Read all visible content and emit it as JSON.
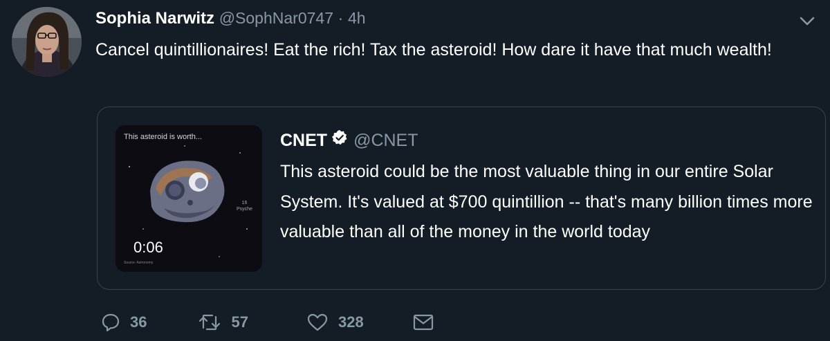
{
  "tweet": {
    "author_name": "Sophia Narwitz",
    "author_handle": "@SophNar0747",
    "separator": "·",
    "time": "4h",
    "text": "Cancel quintillionaires! Eat the rich! Tax the asteroid! How dare it have that much wealth!"
  },
  "quoted_tweet": {
    "author_name": "CNET",
    "author_handle": "@CNET",
    "verified": true,
    "text": "This asteroid could be the most valuable thing in our entire Solar System. It's valued at $700 quintillion -- that's many billion times more valuable than all of the money in the world today",
    "media": {
      "caption": "This asteroid is worth...",
      "side_text": "16\nPsyche",
      "duration": "0:06",
      "footnote": "Source: Astronomy"
    }
  },
  "actions": {
    "reply_count": "36",
    "retweet_count": "57",
    "like_count": "328"
  },
  "colors": {
    "background": "#141d26",
    "secondary_text": "#8899a6",
    "border": "#38444d"
  },
  "icons": {
    "caret": "chevron-down-icon",
    "verified": "verified-badge-icon",
    "reply": "reply-icon",
    "retweet": "retweet-icon",
    "like": "heart-icon",
    "dm": "envelope-icon"
  }
}
